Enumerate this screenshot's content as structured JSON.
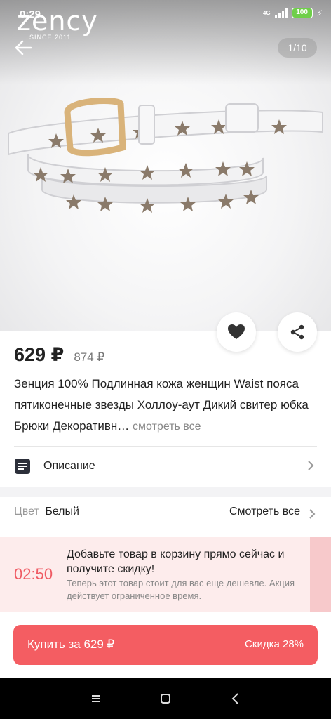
{
  "status_bar": {
    "time": "0:29",
    "network": "4G",
    "battery": "100"
  },
  "brand": {
    "name": "zency",
    "tagline": "SINCE 2011"
  },
  "gallery": {
    "counter": "1/10"
  },
  "product": {
    "price": "629 ₽",
    "old_price": "874 ₽",
    "title": "Зенция 100% Подлинная кожа женщин Waist пояса пятиконечные звезды Холлоу-аут Дикий свитер юбка Брюки Декоративн…",
    "see_all_label": "смотреть все"
  },
  "description": {
    "label": "Описание"
  },
  "color": {
    "key": "Цвет",
    "value": "Белый",
    "see_all": "Смотреть все"
  },
  "promo": {
    "timer": "02:50",
    "title": "Добавьте товар в корзину прямо сейчас и получите скидку!",
    "subtitle": "Теперь этот товар стоит для вас еще дешевле. Акция действует ограниченное время."
  },
  "buy": {
    "label": "Купить за 629 ₽",
    "discount": "Скидка 28%"
  },
  "colors": {
    "accent": "#f45d62",
    "timer": "#ef5a63",
    "promo_bg": "#fdecec"
  },
  "icons": [
    "back-arrow-icon",
    "heart-icon",
    "share-icon",
    "document-icon",
    "chevron-right-icon",
    "menu-icon",
    "home-square-icon",
    "back-triangle-icon"
  ]
}
